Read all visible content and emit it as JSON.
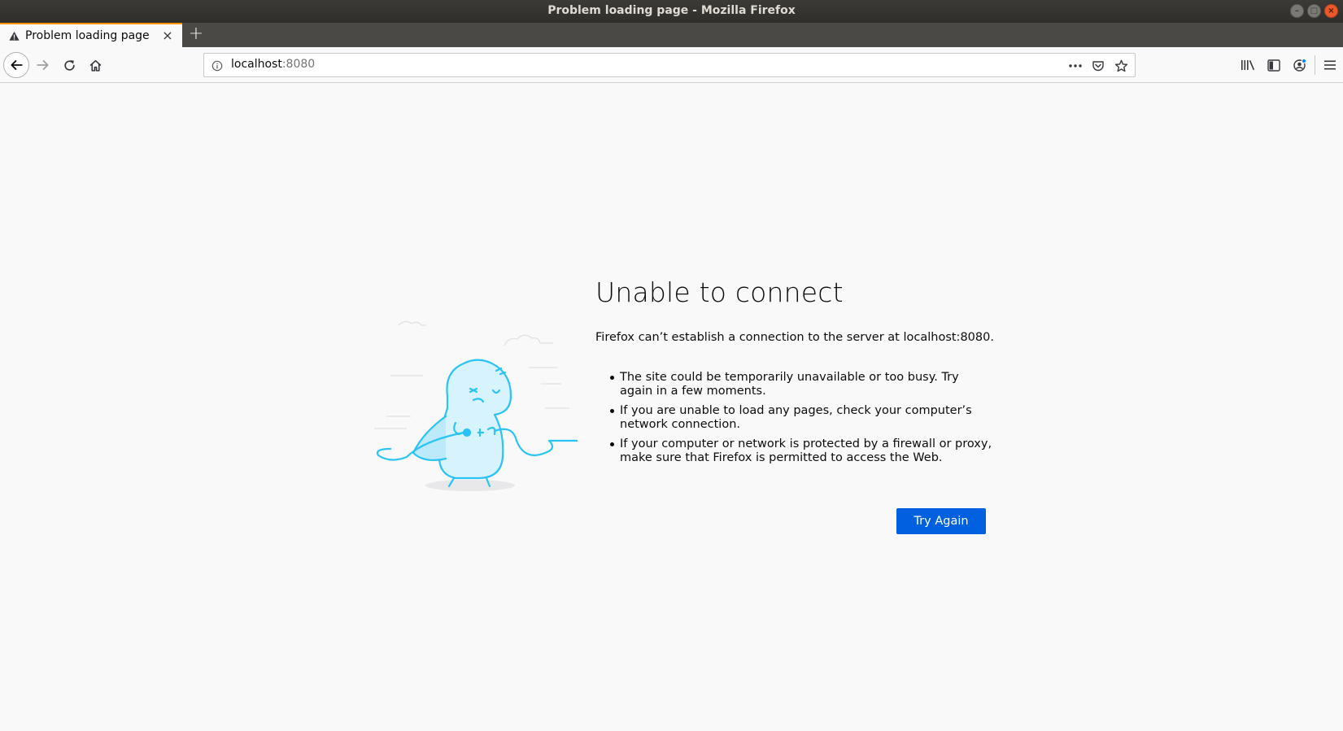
{
  "window": {
    "title": "Problem loading page - Mozilla Firefox",
    "controls": {
      "minimize": "–",
      "maximize": "□",
      "close": "×"
    }
  },
  "tab": {
    "title": "Problem loading page",
    "icon": "warning-icon",
    "close_glyph": "×"
  },
  "new_tab_glyph": "+",
  "urlbar": {
    "host": "localhost",
    "port": ":8080"
  },
  "error": {
    "title": "Unable to connect",
    "description": "Firefox can’t establish a connection to the server at localhost:8080.",
    "reasons": [
      "The site could be temporarily unavailable or too busy. Try again in a few moments.",
      "If you are unable to load any pages, check your computer’s network connection.",
      "If your computer or network is protected by a firewall or proxy, make sure that Firefox is permitted to access the Web."
    ],
    "button_label": "Try Again"
  },
  "colors": {
    "accent": "#0060df",
    "tab_highlight": "#ff9400",
    "illustration": "#2ac3f6"
  }
}
